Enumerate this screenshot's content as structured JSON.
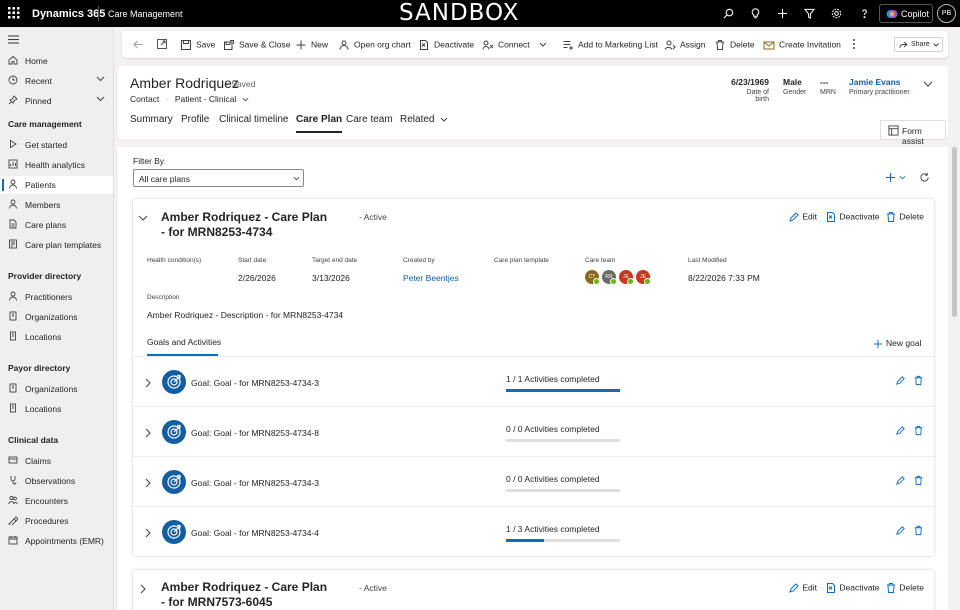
{
  "topbar": {
    "brand": "Dynamics 365",
    "app_name": "Care Management",
    "environment_banner": "SANDBOX",
    "copilot_label": "Copilot",
    "avatar_initials": "PB",
    "icons": [
      "waffle-icon",
      "search-icon",
      "lightbulb-icon",
      "add-icon",
      "filter-icon",
      "settings-icon",
      "help-icon"
    ]
  },
  "sidebar": {
    "top_items": [
      {
        "label": "Home",
        "icon": "home-icon"
      },
      {
        "label": "Recent",
        "icon": "clock-icon"
      },
      {
        "label": "Pinned",
        "icon": "pin-icon"
      }
    ],
    "sections": [
      {
        "title": "Care management",
        "items": [
          "Get started",
          "Health analytics",
          "Patients",
          "Members",
          "Care plans",
          "Care plan templates"
        ]
      },
      {
        "title": "Provider directory",
        "items": [
          "Practitioners",
          "Organizations",
          "Locations"
        ]
      },
      {
        "title": "Payor directory",
        "items": [
          "Organizations",
          "Locations"
        ]
      },
      {
        "title": "Clinical data",
        "items": [
          "Claims",
          "Observations",
          "Encounters",
          "Procedures",
          "Appointments (EMR)"
        ]
      }
    ],
    "active_item": "Patients"
  },
  "commandbar": {
    "save": "Save",
    "save_close": "Save & Close",
    "new": "New",
    "org_chart": "Open org chart",
    "deactivate": "Deactivate",
    "connect": "Connect",
    "add_marketing": "Add to Marketing List",
    "assign": "Assign",
    "delete": "Delete",
    "create_invitation": "Create Invitation",
    "share": "Share"
  },
  "record": {
    "name": "Amber Rodriquez",
    "saved_status": "- Saved",
    "entity": "Contact",
    "form": "Patient - Clinical",
    "fields": [
      {
        "value": "6/23/1969",
        "label": "Date of birth"
      },
      {
        "value": "Male",
        "label": "Gender"
      },
      {
        "value": "---",
        "label": "MRN"
      },
      {
        "value": "Jamie Evans",
        "label": "Primary practitioner"
      }
    ]
  },
  "tabs": [
    "Summary",
    "Profile",
    "Clinical timeline",
    "Care Plan",
    "Care team",
    "Related"
  ],
  "selected_tab": "Care Plan",
  "form_assist": "Form assist",
  "filter": {
    "label": "Filter By",
    "value": "All care plans"
  },
  "care_plans": [
    {
      "title": "Amber Rodriquez - Care Plan - for MRN8253-4734",
      "status": "- Active",
      "actions": [
        "Edit",
        "Deactivate",
        "Delete"
      ],
      "fields": {
        "health_conditions_label": "Health condition(s)",
        "start_date_label": "Start date",
        "start_date": "2/26/2026",
        "target_end_label": "Target end date",
        "target_end": "3/13/2026",
        "created_by_label": "Created by",
        "created_by": "Peter Beentjes",
        "template_label": "Care plan template",
        "care_team_label": "Care team",
        "care_team": [
          {
            "initials": "CT",
            "color": "#8a6a1a"
          },
          {
            "initials": "RR",
            "color": "#6b6b6b"
          },
          {
            "initials": "JE",
            "color": "#c4391f"
          },
          {
            "initials": "JE",
            "color": "#c4391f"
          }
        ],
        "last_modified_label": "Last Modified",
        "last_modified": "8/22/2026 7:33 PM",
        "description_label": "Description",
        "description": "Amber Rodriquez - Description - for MRN8253-4734"
      },
      "goals_tab": "Goals and Activities",
      "new_goal": "New goal",
      "goals": [
        {
          "name": "Goal: Goal - for MRN8253-4734-3",
          "progress": "1 / 1 Activities completed",
          "fraction": 1.0
        },
        {
          "name": "Goal: Goal - for MRN8253-4734-8",
          "progress": "0 / 0 Activities completed",
          "fraction": 0.0
        },
        {
          "name": "Goal: Goal - for MRN8253-4734-3",
          "progress": "0 / 0 Activities completed",
          "fraction": 0.0
        },
        {
          "name": "Goal: Goal - for MRN8253-4734-4",
          "progress": "1 / 3 Activities completed",
          "fraction": 0.333
        }
      ]
    },
    {
      "title": "Amber Rodriquez - Care Plan - for MRN7573-6045",
      "status": "- Active",
      "actions": [
        "Edit",
        "Deactivate",
        "Delete"
      ]
    }
  ],
  "colors": {
    "accent": "#0f6cbd",
    "topbar": "#000000",
    "goal_icon": "#115ea3"
  }
}
